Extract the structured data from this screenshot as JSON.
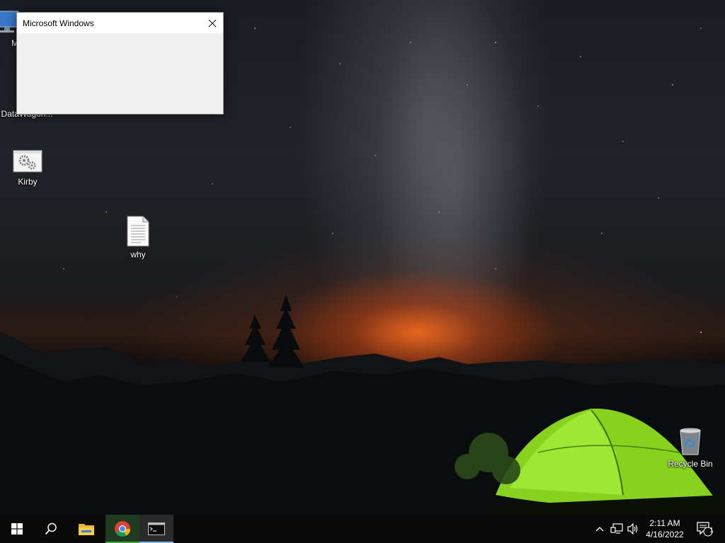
{
  "desktop": {
    "icons": [
      {
        "label": "My",
        "icon": "computer-icon"
      },
      {
        "label": "DataWagon...",
        "icon": "datawagon-app-icon"
      },
      {
        "label": "Kirby",
        "icon": "settings-gears-file-icon"
      },
      {
        "label": "why",
        "icon": "text-file-icon"
      },
      {
        "label": "Recycle Bin",
        "icon": "recycle-bin-icon"
      }
    ]
  },
  "dialog": {
    "title": "Microsoft Windows",
    "close_icon": "close-icon"
  },
  "taskbar": {
    "buttons": [
      {
        "name": "start",
        "icon": "windows-logo-icon"
      },
      {
        "name": "search",
        "icon": "search-icon"
      },
      {
        "name": "file-explorer",
        "icon": "folder-icon"
      },
      {
        "name": "chrome",
        "icon": "chrome-icon"
      },
      {
        "name": "command-prompt",
        "icon": "cmd-icon",
        "active": true
      }
    ],
    "tray": {
      "icons": [
        "chevron-up-icon",
        "network-icon",
        "volume-icon"
      ],
      "time": "2:11 AM",
      "date": "4/16/2022",
      "notification_count": "1"
    }
  },
  "colors": {
    "taskbar_bg": "#0a0a0b",
    "dialog_bg": "#f0f0f0",
    "active_indicator": "#76b9ed",
    "tent_green": "#8fd82a"
  }
}
